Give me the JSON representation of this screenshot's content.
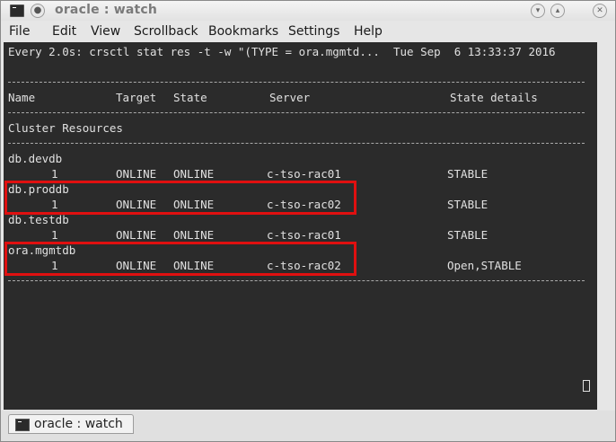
{
  "window": {
    "title": "oracle : watch",
    "icon": "terminal-icon",
    "pin_icon": "pin-icon",
    "controls": [
      "minimize-icon",
      "maximize-icon",
      "close-icon"
    ]
  },
  "menu": {
    "items": [
      "File",
      "Edit",
      "View",
      "Scrollback",
      "Bookmarks",
      "Settings",
      "Help"
    ]
  },
  "terminal": {
    "watch_line": "Every 2.0s: crsctl stat res -t -w \"(TYPE = ora.mgmtd...  Tue Sep  6 13:33:37 2016",
    "headers": {
      "name": "Name",
      "target": "Target",
      "state": "State",
      "server": "Server",
      "details": "State details"
    },
    "section_title": "Cluster Resources",
    "resources": [
      {
        "name": "db.devdb",
        "instance": "1",
        "target": "ONLINE",
        "state": "ONLINE",
        "server": "c-tso-rac01",
        "details": "STABLE",
        "highlighted": false
      },
      {
        "name": "db.proddb",
        "instance": "1",
        "target": "ONLINE",
        "state": "ONLINE",
        "server": "c-tso-rac02",
        "details": "STABLE",
        "highlighted": true
      },
      {
        "name": "db.testdb",
        "instance": "1",
        "target": "ONLINE",
        "state": "ONLINE",
        "server": "c-tso-rac01",
        "details": "STABLE",
        "highlighted": false
      },
      {
        "name": "ora.mgmtdb",
        "instance": "1",
        "target": "ONLINE",
        "state": "ONLINE",
        "server": "c-tso-rac02",
        "details": "Open,STABLE",
        "highlighted": true
      }
    ],
    "highlight_color": "#e01010",
    "background_color": "#2b2b2b",
    "text_color": "#e0e0e0"
  },
  "statusbar": {
    "tab_label": "oracle : watch",
    "tab_icon": "terminal-icon"
  }
}
